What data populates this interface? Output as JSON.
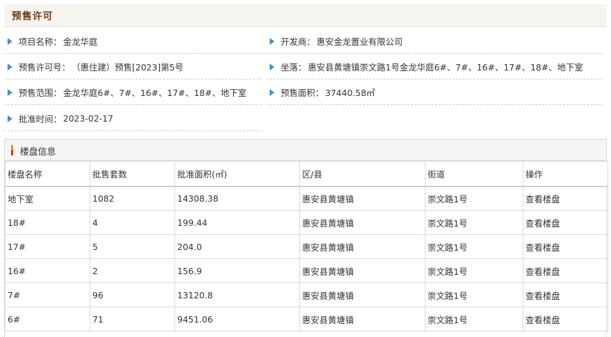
{
  "section": {
    "title": "预售许可"
  },
  "info": {
    "project_name": {
      "label": "项目名称：",
      "value": "金龙华庭"
    },
    "developer": {
      "label": "开发商：",
      "value": "惠安金龙置业有限公司"
    },
    "permit_no": {
      "label": "预售许可号：",
      "value": "（惠住建）预售[2023]第5号"
    },
    "location": {
      "label": "坐落：",
      "value": "惠安县黄塘镇崇文路1号金龙华庭6#、7#、16#、17#、18#、地下室"
    },
    "scope": {
      "label": "预售范围：",
      "value": "金龙华庭6#、7#、16#、17#、18#、地下室"
    },
    "area": {
      "label": "预售面积：",
      "value": "37440.58㎡"
    },
    "approval_date": {
      "label": "批准时间：",
      "value": "2023-02-17"
    }
  },
  "buildings_panel": {
    "title": "楼盘信息",
    "columns": [
      "楼盘名称",
      "批售套数",
      "批准面积(㎡)",
      "区/县",
      "街道",
      "操作"
    ],
    "rows": [
      {
        "name": "地下室",
        "units": "1082",
        "area": "14308.38",
        "district": "惠安县黄塘镇",
        "street": "崇文路1号",
        "action": "查看楼盘"
      },
      {
        "name": "18#",
        "units": "4",
        "area": "199.44",
        "district": "惠安县黄塘镇",
        "street": "崇文路1号",
        "action": "查看楼盘"
      },
      {
        "name": "17#",
        "units": "5",
        "area": "204.0",
        "district": "惠安县黄塘镇",
        "street": "崇文路1号",
        "action": "查看楼盘"
      },
      {
        "name": "16#",
        "units": "2",
        "area": "156.9",
        "district": "惠安县黄塘镇",
        "street": "崇文路1号",
        "action": "查看楼盘"
      },
      {
        "name": "7#",
        "units": "96",
        "area": "13120.8",
        "district": "惠安县黄塘镇",
        "street": "崇文路1号",
        "action": "查看楼盘"
      },
      {
        "name": "6#",
        "units": "71",
        "area": "9451.06",
        "district": "惠安县黄塘镇",
        "street": "崇文路1号",
        "action": "查看楼盘"
      }
    ]
  },
  "colors": {
    "section_title": "#6b3a14",
    "bullet": "#4a8fc7",
    "panel_bar_top": "#f08a24",
    "panel_bar_bottom": "#d63a20"
  }
}
